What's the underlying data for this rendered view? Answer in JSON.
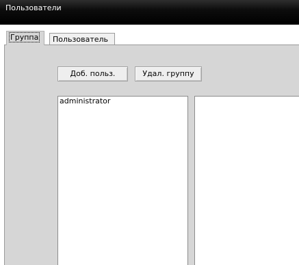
{
  "window": {
    "title": "Пользователи"
  },
  "tabs": [
    {
      "label": "Группа",
      "active": true
    },
    {
      "label": "Пользователь",
      "active": false
    }
  ],
  "toolbar": {
    "add_user_label": "Доб. польз.",
    "delete_group_label": "Удал. группу"
  },
  "users_list": {
    "items": [
      "administrator"
    ]
  },
  "colors": {
    "titlebar": "#000000",
    "panel": "#d6d6d6",
    "list_bg": "#ffffff"
  }
}
